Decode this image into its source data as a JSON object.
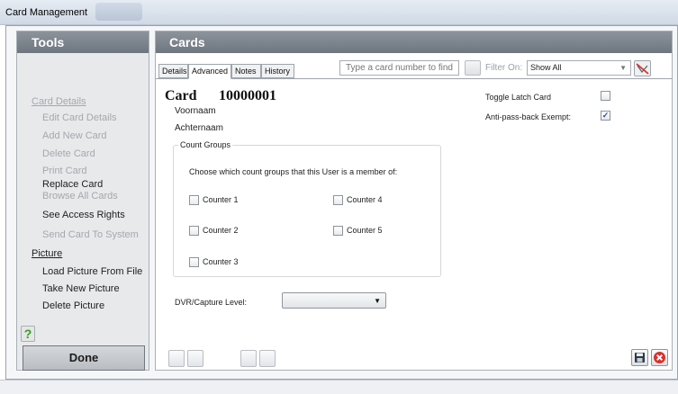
{
  "window": {
    "title": "Card Management"
  },
  "tools": {
    "header": "Tools",
    "items": [
      {
        "label": "Card Details"
      },
      {
        "label": "Edit Card Details"
      },
      {
        "label": "Add New Card"
      },
      {
        "label": "Delete Card"
      },
      {
        "label": "Print Card"
      },
      {
        "label": "Replace Card"
      },
      {
        "label": "Browse All Cards"
      },
      {
        "label": "See Access Rights"
      },
      {
        "label": "Send Card To System"
      },
      {
        "label": "Picture"
      },
      {
        "label": "Load Picture From File"
      },
      {
        "label": "Take New Picture"
      },
      {
        "label": "Delete Picture"
      }
    ],
    "help_label": "?",
    "done_label": "Done"
  },
  "cards": {
    "header": "Cards",
    "tabs": [
      {
        "label": "Details"
      },
      {
        "label": "Advanced"
      },
      {
        "label": "Notes"
      },
      {
        "label": "History"
      }
    ],
    "search_placeholder": "Type a card number to find",
    "filter_label": "Filter On:",
    "filter_value": "Show All",
    "card_label": "Card",
    "card_number": "10000001",
    "first_name": "Voornaam",
    "last_name": "Achternaam",
    "toggle_latch_label": "Toggle Latch Card",
    "toggle_latch_checked": false,
    "anti_passback_label": "Anti-pass-back Exempt:",
    "anti_passback_checked": true,
    "count_groups": {
      "legend": "Count Groups",
      "description": "Choose which count groups that this User is a member of:",
      "counters": [
        {
          "label": "Counter 1",
          "checked": false
        },
        {
          "label": "Counter 2",
          "checked": false
        },
        {
          "label": "Counter 3",
          "checked": false
        },
        {
          "label": "Counter 4",
          "checked": false
        },
        {
          "label": "Counter 5",
          "checked": false
        }
      ]
    },
    "dvr_label": "DVR/Capture Level:",
    "dvr_value": ""
  },
  "icons": {
    "save": "floppy-disk-icon",
    "cancel": "red-x-circle-icon",
    "clear_filter": "crossed-out-icon",
    "help": "question-mark-icon"
  },
  "colors": {
    "header_bg": "#7d858e",
    "done_bg": "#c5c9cd",
    "help_green": "#3a9c1c",
    "cancel_red": "#d8322b",
    "check_blue": "#2b4f9b"
  }
}
